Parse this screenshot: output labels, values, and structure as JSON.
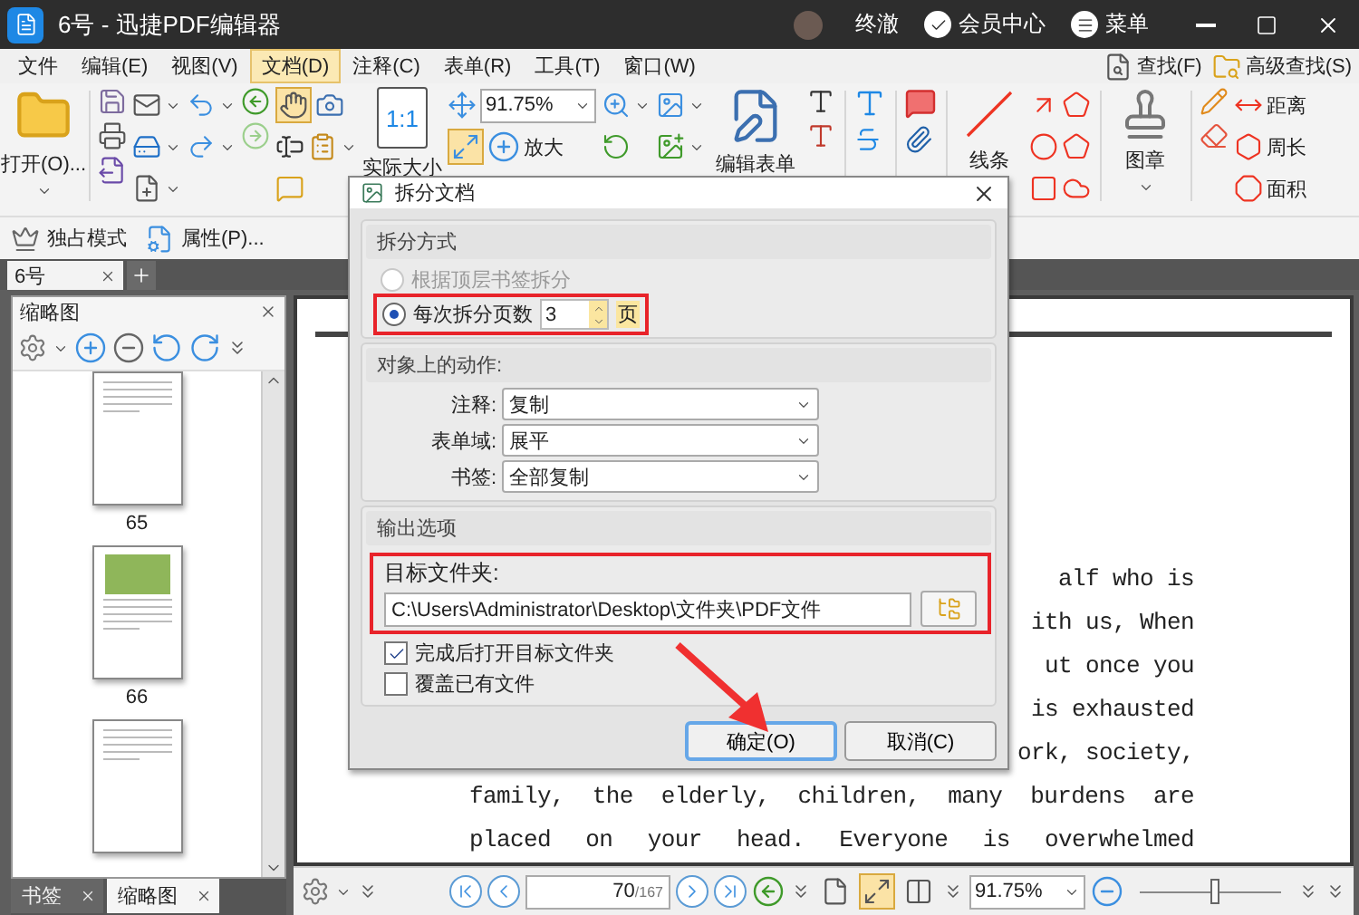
{
  "window": {
    "title": "6号 - 迅捷PDF编辑器",
    "user": "终澈",
    "member": "会员中心",
    "menu": "菜单"
  },
  "menu_bar": [
    {
      "label": "文件",
      "selected": false
    },
    {
      "label": "编辑(E)",
      "selected": false
    },
    {
      "label": "视图(V)",
      "selected": false
    },
    {
      "label": "文档(D)",
      "selected": true
    },
    {
      "label": "注释(C)",
      "selected": false
    },
    {
      "label": "表单(R)",
      "selected": false
    },
    {
      "label": "工具(T)",
      "selected": false
    },
    {
      "label": "窗口(W)",
      "selected": false
    }
  ],
  "search_links": [
    "查找(F)",
    "高级查找(S)"
  ],
  "ribbon": {
    "open": "打开(O)...",
    "hand_tool_selected": true,
    "fit_selected": true,
    "actual_size_icon": "1:1",
    "actual_size": "实际大小",
    "zoom": "91.75%",
    "zoom_in": "放大",
    "edit_form": "编辑表单",
    "line": "线条",
    "stamp": "图章",
    "measure": [
      "距离",
      "周长",
      "面积"
    ]
  },
  "sub_toolbar": [
    "独占模式",
    "属性(P)..."
  ],
  "doc_tabs": [
    {
      "label": "6号",
      "selected": true
    }
  ],
  "side_panel": {
    "title": "缩略图",
    "thumbnails": [
      {
        "kind": "text",
        "page": "65"
      },
      {
        "kind": "photo",
        "page": "66"
      },
      {
        "kind": "text"
      }
    ]
  },
  "panel_tabs": [
    {
      "label": "书签",
      "selected": false
    },
    {
      "label": "缩略图",
      "selected": true
    }
  ],
  "document": {
    "lines": [
      {
        "kind": "fragment",
        "text": "alf who is"
      },
      {
        "kind": "fragment",
        "text": "ith us, When"
      },
      {
        "kind": "fragment",
        "text": "ut once you"
      },
      {
        "kind": "fragment",
        "text": "is exhausted"
      },
      {
        "kind": "fragment",
        "text": "ork, society,"
      },
      {
        "kind": "full",
        "text": "family, the elderly, children, many burdens are"
      },
      {
        "kind": "full",
        "text": "placed on your head. Everyone is overwhelmed"
      }
    ]
  },
  "status_bar": {
    "page": "70",
    "total": "/167",
    "views": [
      {
        "selected": false
      },
      {
        "selected": true
      },
      {
        "selected": false
      }
    ],
    "zoom": "91.75%",
    "zoom_slider": {
      "level": 0.52
    }
  },
  "dialog": {
    "title": "拆分文档",
    "split_group": {
      "title": "拆分方式",
      "options": [
        {
          "label": "根据顶层书签拆分",
          "selected": false,
          "disabled": true
        },
        {
          "label": "每次拆分页数",
          "selected": true,
          "disabled": false
        }
      ],
      "pages_value": "3",
      "pages_unit": "页"
    },
    "actions_group": {
      "title": "对象上的动作:",
      "fields": [
        {
          "label": "注释:",
          "value": "复制"
        },
        {
          "label": "表单域:",
          "value": "展平"
        },
        {
          "label": "书签:",
          "value": "全部复制"
        }
      ]
    },
    "output_group": {
      "title": "输出选项",
      "folder_label": "目标文件夹:",
      "folder_path": "C:\\Users\\Administrator\\Desktop\\文件夹\\PDF文件",
      "options": [
        {
          "label": "完成后打开目标文件夹",
          "checked": true
        },
        {
          "label": "覆盖已有文件",
          "checked": false
        }
      ]
    },
    "buttons": [
      {
        "label": "确定(O)",
        "focused": true
      },
      {
        "label": "取消(C)",
        "focused": false
      }
    ]
  }
}
